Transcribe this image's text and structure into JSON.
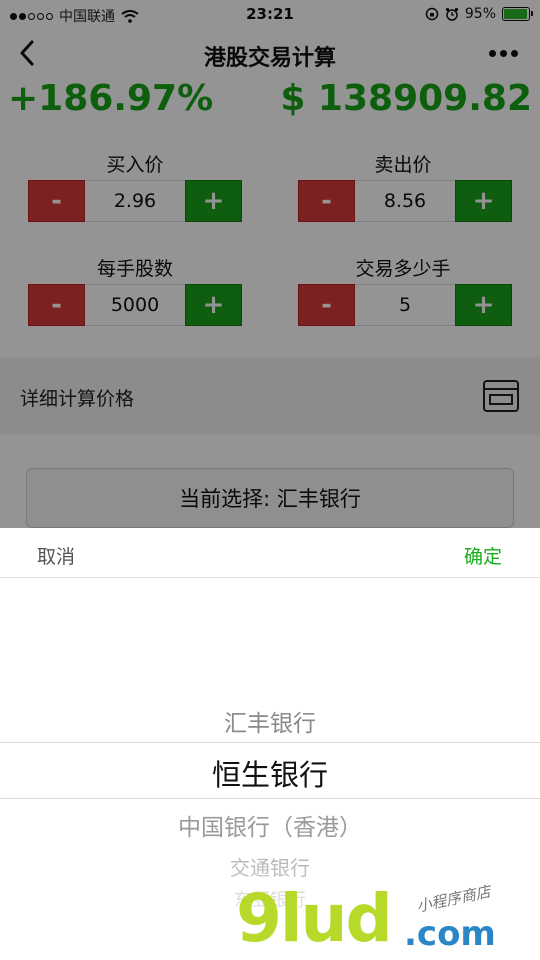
{
  "status_bar": {
    "carrier": "中国联通",
    "time": "23:21",
    "battery": "95%"
  },
  "nav": {
    "title": "港股交易计算"
  },
  "summary": {
    "profit_percent": "+186.97%",
    "profit_amount": "$ 138909.82"
  },
  "fields": {
    "buy_price": {
      "label": "买入价",
      "value": "2.96"
    },
    "sell_price": {
      "label": "卖出价",
      "value": "8.56"
    },
    "shares_per_lot": {
      "label": "每手股数",
      "value": "5000"
    },
    "lots": {
      "label": "交易多少手",
      "value": "5"
    },
    "minus_symbol": "-",
    "plus_symbol": "+"
  },
  "detail": {
    "label": "详细计算价格",
    "icon": "card-icon"
  },
  "current_selection": "当前选择: 汇丰银行",
  "picker": {
    "cancel": "取消",
    "confirm": "确定",
    "options": [
      "汇丰银行",
      "恒生银行",
      "中国银行（香港）",
      "交通银行",
      "东亚银行"
    ],
    "selected_index": 1
  },
  "watermark": {
    "brand": "9lud",
    "domain": ".com",
    "tagline": "小程序商店"
  },
  "colors": {
    "positive": "#17a317",
    "minus_button": "#d43a3a",
    "plus_button": "#1aa01a",
    "confirm": "#1aad19"
  }
}
